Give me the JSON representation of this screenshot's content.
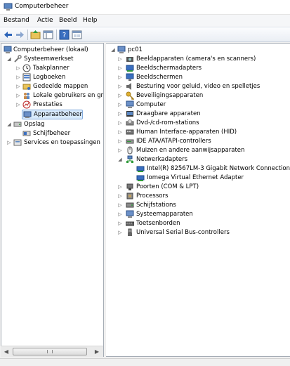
{
  "window": {
    "title": "Computerbeheer",
    "icon": "computer-management-icon"
  },
  "menu": [
    "Bestand",
    "Actie",
    "Beeld",
    "Help"
  ],
  "toolbar": [
    "back-arrow-icon",
    "forward-arrow-icon",
    "up-folder-icon",
    "show-hide-tree-icon",
    "help-icon",
    "properties-icon"
  ],
  "left_tree": {
    "root": "Computerbeheer (lokaal)",
    "systeemwerkset": "Systeemwerkset",
    "taakplanner": "Taakplanner",
    "logboeken": "Logboeken",
    "gedeelde_mappen": "Gedeelde mappen",
    "lokale_gebruikers": "Lokale gebruikers en gro",
    "prestaties": "Prestaties",
    "apparaatbeheer": "Apparaatbeheer",
    "opslag": "Opslag",
    "schijfbeheer": "Schijfbeheer",
    "services": "Services en toepassingen"
  },
  "right_tree": {
    "root": "pc01",
    "items": [
      "Beeldapparaten (camera's en scanners)",
      "Beeldschermadapters",
      "Beeldschermen",
      "Besturing voor geluid, video en spelletjes",
      "Beveiligingsapparaten",
      "Computer",
      "Draagbare apparaten",
      "Dvd-/cd-rom-stations",
      "Human Interface-apparaten (HID)",
      "IDE ATA/ATAPI-controllers",
      "Muizen en andere aanwijsapparaten",
      "Netwerkadapters",
      "Intel(R) 82567LM-3 Gigabit Network Connection",
      "Iomega Virtual Ethernet Adapter",
      "Poorten (COM & LPT)",
      "Processors",
      "Schijfstations",
      "Systeemapparaten",
      "Toetsenborden",
      "Universal Serial Bus-controllers"
    ]
  },
  "colors": {
    "selection": "#d8eafc",
    "selection_border": "#84acdd",
    "toolbar_icon_blue": "#2a63b8"
  }
}
